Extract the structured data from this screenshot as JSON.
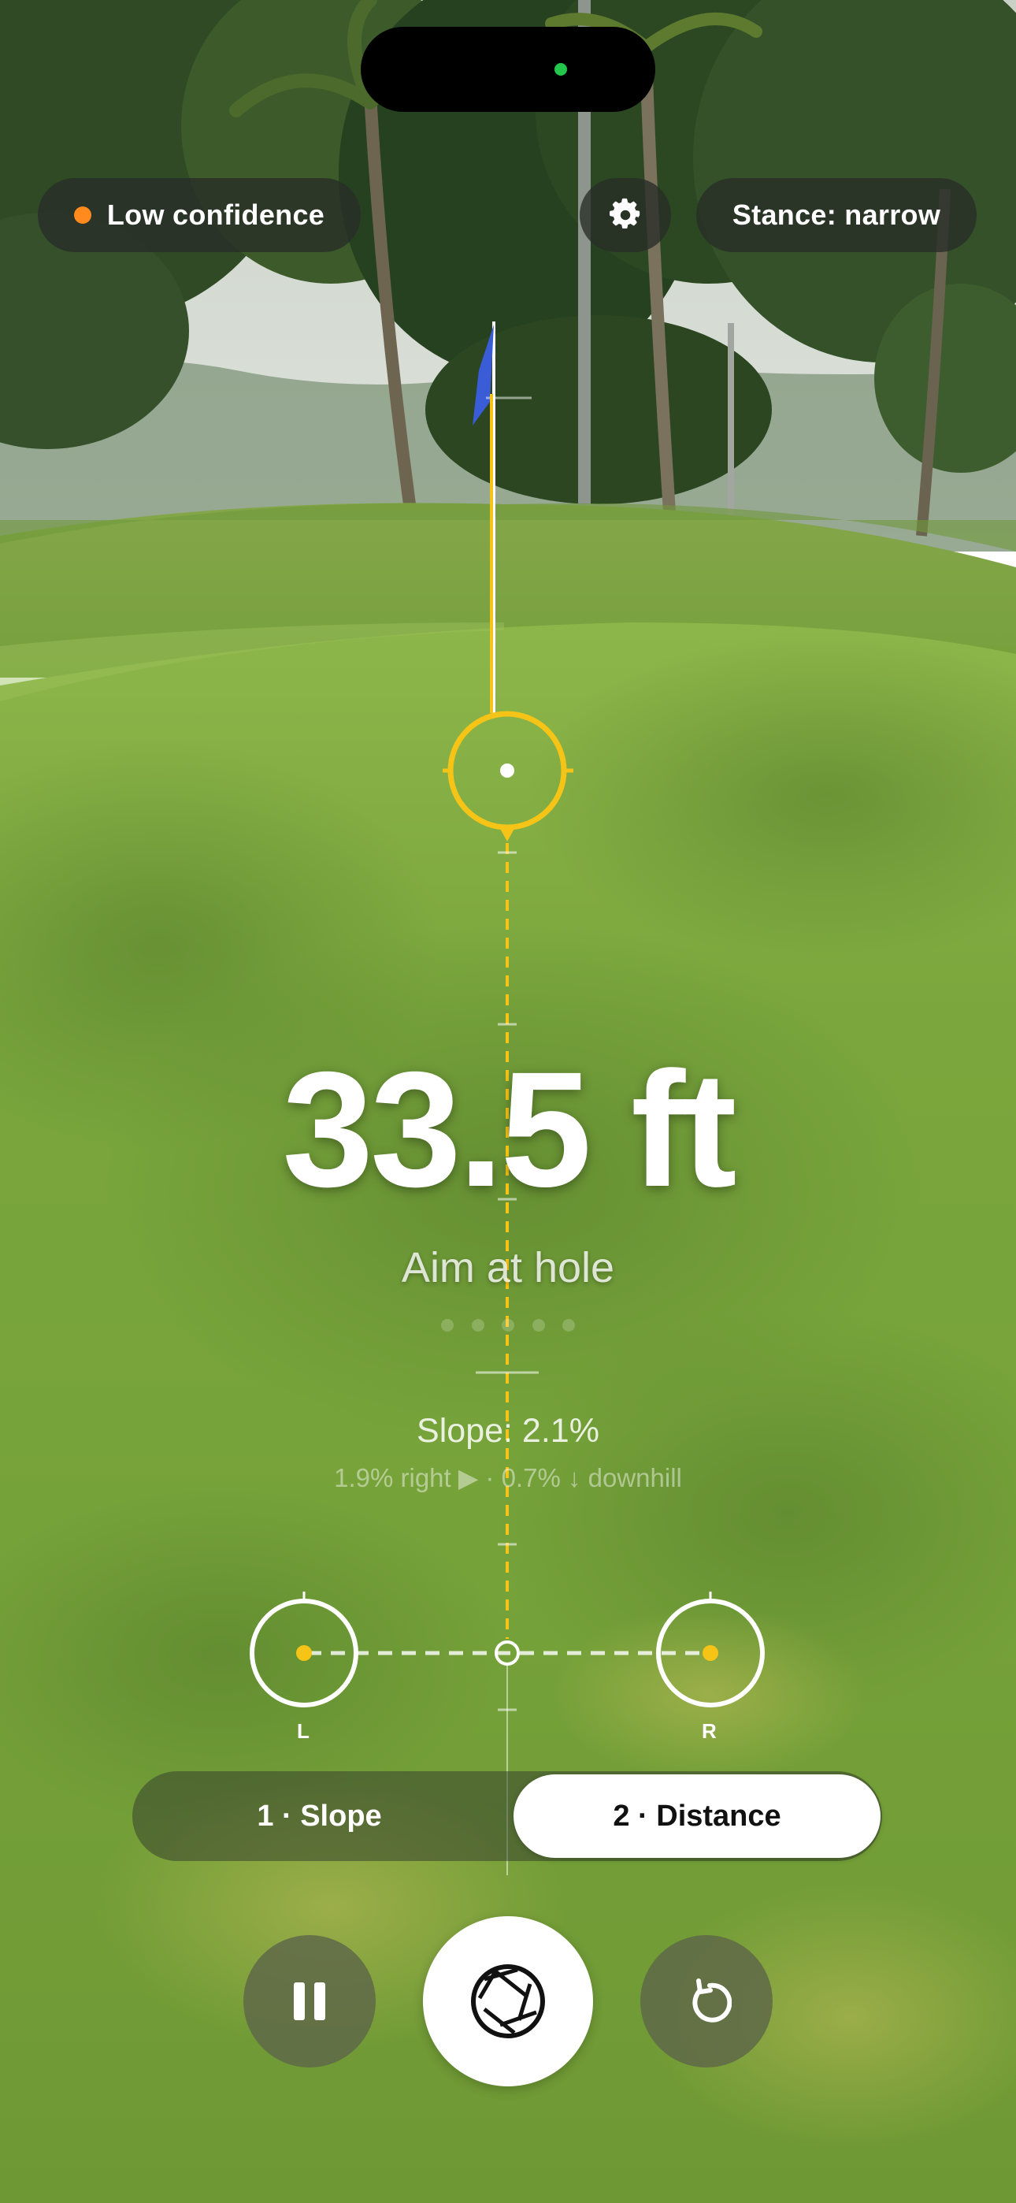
{
  "status": {
    "confidence_label": "Low confidence",
    "confidence_color": "#ff8a1e",
    "stance_label": "Stance: narrow",
    "camera_indicator_color": "#22c64a"
  },
  "readout": {
    "distance": "33.5 ft",
    "instruction": "Aim at hole",
    "slope": "Slope: 2.1%",
    "slope_detail": "1.9% right ▶ · 0.7% ↓ downhill"
  },
  "markers": {
    "left_label": "L",
    "right_label": "R",
    "reticle_color": "#f6c416"
  },
  "mode_selector": {
    "options": [
      "1 · Slope",
      "2 · Distance"
    ],
    "selected": "2 · Distance"
  },
  "controls": {
    "pause_icon": "pause-icon",
    "capture_icon": "camera-aperture-icon",
    "reset_icon": "reset-icon",
    "settings_icon": "gear-icon"
  },
  "page_indicator": {
    "pages": 5
  }
}
